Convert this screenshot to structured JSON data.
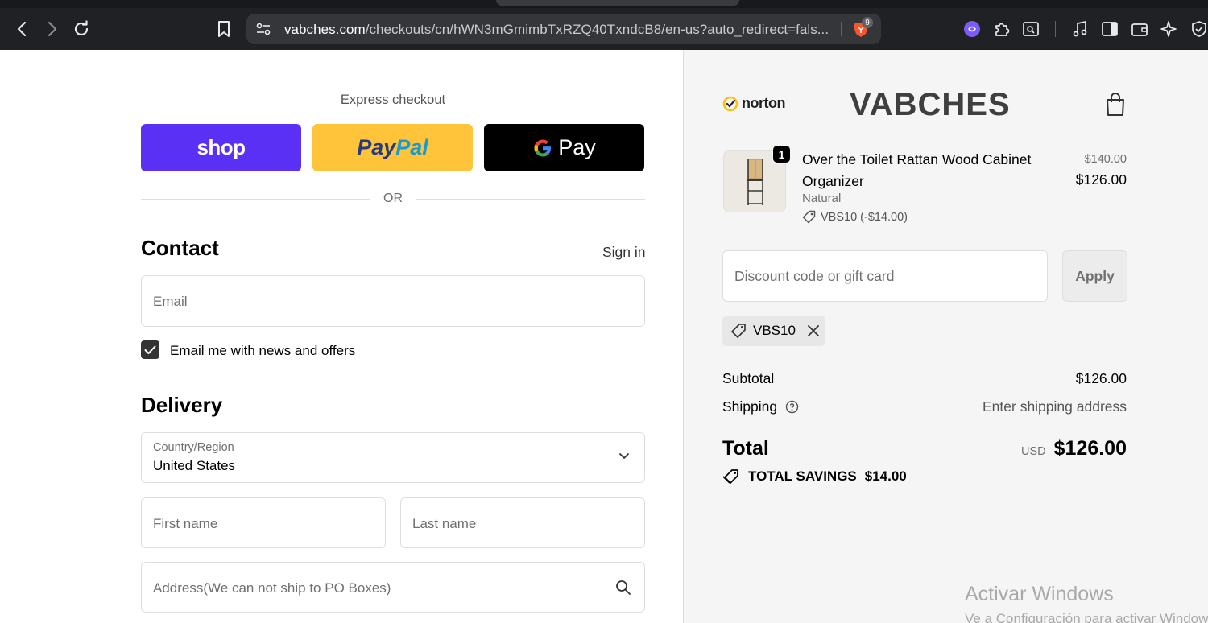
{
  "browser": {
    "url_host": "vabches.com",
    "url_rest": "/checkouts/cn/hWN3mGmimbTxRZQ40TxndcB8/en-us?auto_redirect=fals...",
    "brave_badge_count": "9"
  },
  "express": {
    "title": "Express checkout",
    "shop_label": "shop",
    "paypal_part1": "Pay",
    "paypal_part2": "Pal",
    "gpay_label": "Pay",
    "or_label": "OR"
  },
  "contact": {
    "heading": "Contact",
    "sign_in": "Sign in",
    "email_placeholder": "Email",
    "newsletter_label": "Email me with news and offers",
    "newsletter_checked": true
  },
  "delivery": {
    "heading": "Delivery",
    "country_label": "Country/Region",
    "country_value": "United States",
    "first_name_placeholder": "First name",
    "last_name_placeholder": "Last name",
    "address_placeholder": "Address(We can not ship to PO Boxes)"
  },
  "summary": {
    "norton_label": "norton",
    "brand": "VABCHES",
    "product": {
      "quantity": "1",
      "name": "Over the Toilet Rattan Wood Cabinet Organizer",
      "variant": "Natural",
      "discount_line": "VBS10 (-$14.00)",
      "price_original": "$140.00",
      "price_current": "$126.00"
    },
    "discount_placeholder": "Discount code or gift card",
    "apply_label": "Apply",
    "applied_code": "VBS10",
    "subtotal_label": "Subtotal",
    "subtotal_value": "$126.00",
    "shipping_label": "Shipping",
    "shipping_value": "Enter shipping address",
    "total_label": "Total",
    "total_currency": "USD",
    "total_value": "$126.00",
    "savings_label": "TOTAL SAVINGS",
    "savings_value": "$14.00"
  },
  "watermark": {
    "line1": "Activar Windows",
    "line2": "Ve a Configuración para activar Windows."
  },
  "colors": {
    "shop_pay": "#5a31f4",
    "paypal": "#ffc439",
    "gpay": "#000000",
    "summary_bg": "#f5f5f5"
  }
}
